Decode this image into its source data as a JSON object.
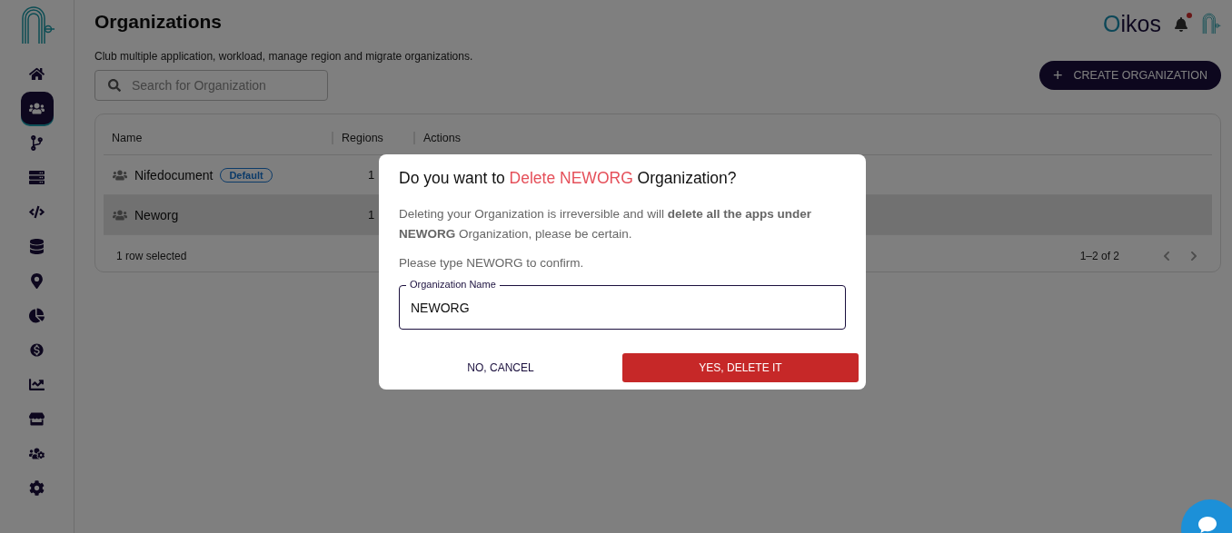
{
  "sidebar": {
    "items": [
      {
        "selected": false
      },
      {
        "selected": true
      },
      {
        "selected": false
      },
      {
        "selected": false
      },
      {
        "selected": false
      },
      {
        "selected": false
      },
      {
        "selected": false
      },
      {
        "selected": false
      },
      {
        "selected": false
      },
      {
        "selected": false
      },
      {
        "selected": false
      },
      {
        "selected": false
      },
      {
        "selected": false
      }
    ]
  },
  "header": {
    "title": "Organizations",
    "subtitle": "Club multiple application, workload, manage region and migrate organizations.",
    "brand_initial": "O",
    "brand_rest": "ikos",
    "has_notification": true
  },
  "search": {
    "placeholder": "Search for Organization"
  },
  "create_button": {
    "icon": "+",
    "label": "CREATE ORGANIZATION"
  },
  "table": {
    "columns": [
      "Name",
      "Regions",
      "Actions"
    ],
    "rows": [
      {
        "name": "Nifedocument",
        "badge": "Default",
        "regions": "1",
        "selected": false
      },
      {
        "name": "Neworg",
        "regions": "1",
        "selected": true
      }
    ],
    "footer": {
      "selection": "1 row selected",
      "range": "1–2 of 2"
    }
  },
  "dialog": {
    "title": "Do you want to **Delete NEWORG** Organization?",
    "message": "Deleting your Organization is irreversible and will **delete all the apps under NEWORG** Organization, please be certain.",
    "prompt": "Please type NEWORG to confirm.",
    "field_label": "Organization Name",
    "field_value": "NEWORG",
    "cancel": "NO, CANCEL",
    "confirm": "YES, DELETE IT"
  }
}
